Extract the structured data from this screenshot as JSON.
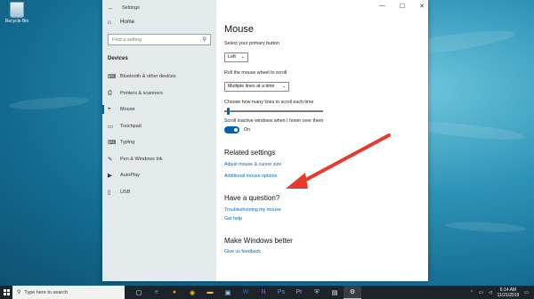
{
  "desktop": {
    "recycle_bin_label": "Recycle Bin"
  },
  "window": {
    "title": "Settings",
    "controls": {
      "minimize": "—",
      "maximize": "☐",
      "close": "✕"
    }
  },
  "sidebar": {
    "home_label": "Home",
    "search_placeholder": "Find a setting",
    "section_heading": "Devices",
    "items": [
      {
        "label": "Bluetooth & other devices",
        "icon": "bluetooth-icon",
        "glyph": "⌨"
      },
      {
        "label": "Printers & scanners",
        "icon": "printer-icon",
        "glyph": "⎙"
      },
      {
        "label": "Mouse",
        "icon": "mouse-icon",
        "glyph": "⌖"
      },
      {
        "label": "Touchpad",
        "icon": "touchpad-icon",
        "glyph": "▭"
      },
      {
        "label": "Typing",
        "icon": "keyboard-icon",
        "glyph": "⌨"
      },
      {
        "label": "Pen & Windows Ink",
        "icon": "pen-icon",
        "glyph": "✎"
      },
      {
        "label": "AutoPlay",
        "icon": "autoplay-icon",
        "glyph": "▶"
      },
      {
        "label": "USB",
        "icon": "usb-icon",
        "glyph": "▯"
      }
    ]
  },
  "main": {
    "title": "Mouse",
    "primary_button": {
      "label": "Select your primary button",
      "value": "Left"
    },
    "scroll_wheel": {
      "label": "Roll the mouse wheel to scroll",
      "value": "Multiple lines at a time"
    },
    "lines_to_scroll": {
      "label": "Choose how many lines to scroll each time",
      "value_fraction": 0.03
    },
    "inactive_scroll": {
      "label": "Scroll inactive windows when I hover over them",
      "state": "On"
    },
    "related": {
      "heading": "Related settings",
      "links": [
        "Adjust mouse & cursor size",
        "Additional mouse options"
      ]
    },
    "question": {
      "heading": "Have a question?",
      "links": [
        "Troubleshooting my mouse",
        "Get help"
      ]
    },
    "better": {
      "heading": "Make Windows better",
      "link": "Give us feedback"
    }
  },
  "annotation_color": "#e8392c",
  "taskbar": {
    "search_placeholder": "Type here to search",
    "icons": [
      "task-view-icon",
      "edge-icon",
      "firefox-icon",
      "chrome-icon",
      "file-explorer-icon",
      "store-icon",
      "word-icon",
      "onenote-icon",
      "photoshop-icon",
      "premiere-icon",
      "defender-icon",
      "terminal-icon",
      "settings-icon"
    ],
    "time": "6:14 AM",
    "date": "11/21/2019"
  }
}
